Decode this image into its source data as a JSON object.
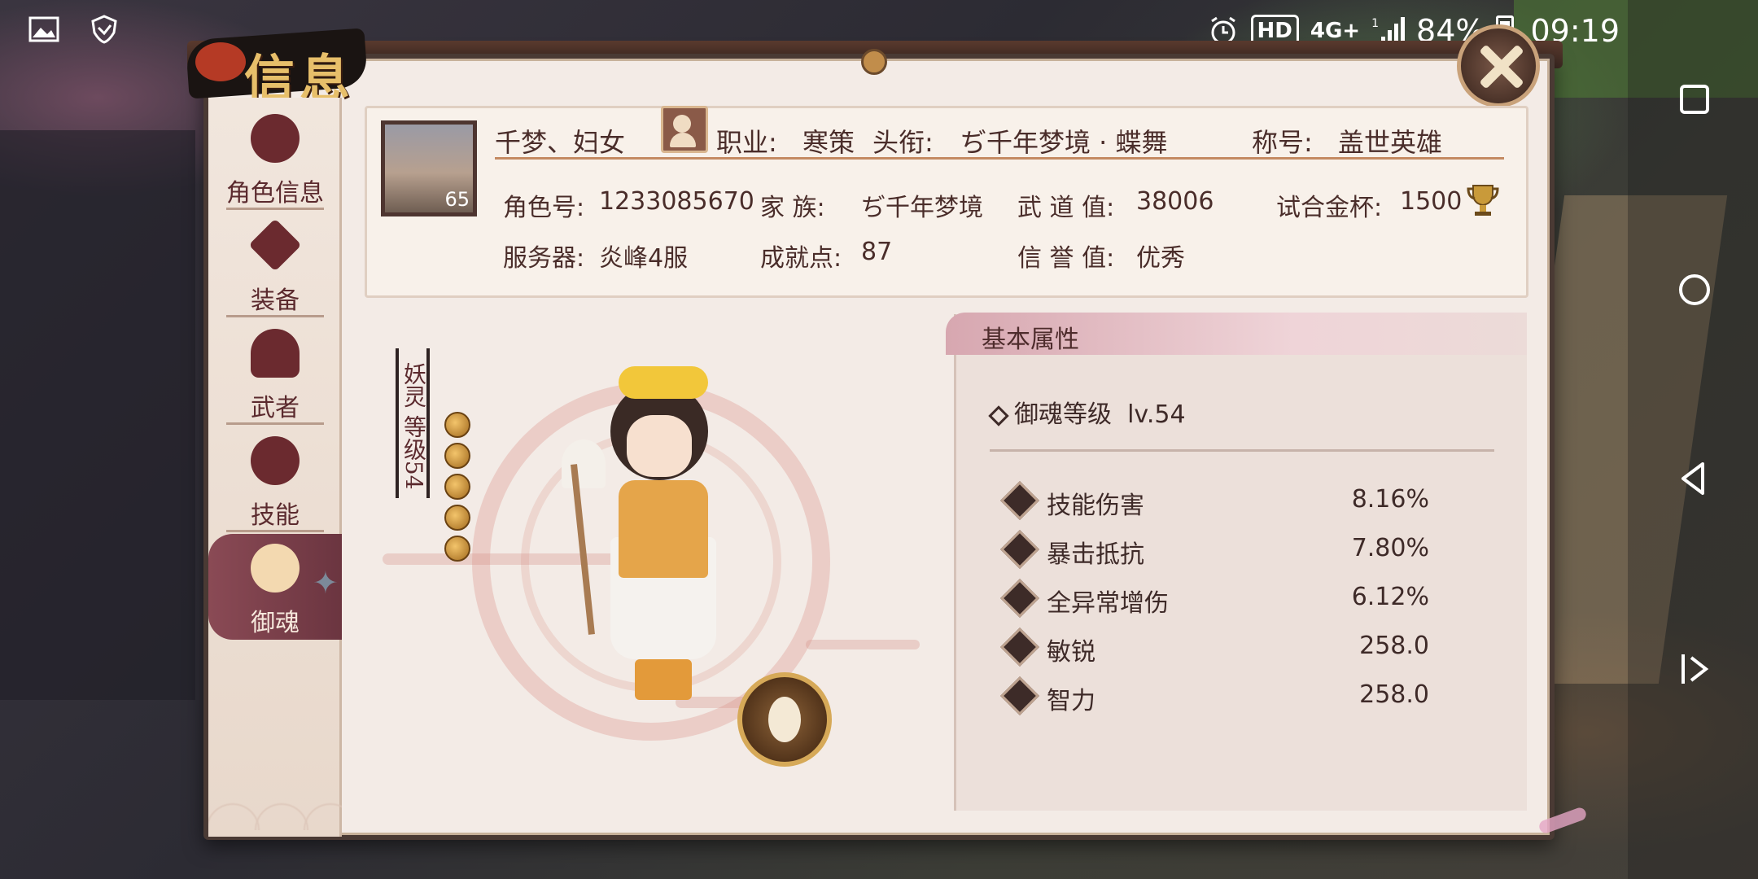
{
  "status_bar": {
    "network": "4G+",
    "signal_bars": "1",
    "battery": "84%",
    "time": "09:19",
    "hd_label": "HD"
  },
  "window": {
    "title": "信息"
  },
  "sidebar": {
    "items": [
      {
        "label": "角色信息",
        "icon": "character-info-icon"
      },
      {
        "label": "装备",
        "icon": "equipment-swords-icon"
      },
      {
        "label": "武者",
        "icon": "warrior-helmet-icon"
      },
      {
        "label": "技能",
        "icon": "skill-swirl-icon"
      },
      {
        "label": "御魂",
        "icon": "soul-fox-icon",
        "active": true
      }
    ]
  },
  "profile": {
    "avatar_level": "65",
    "name": "千梦、妇女",
    "class_label": "职业:",
    "class_value": "寒策",
    "rank_label": "头衔:",
    "rank_value": "ぢ千年梦境 · 蝶舞",
    "title_label": "称号:",
    "title_value": "盖世英雄",
    "role_id_label": "角色号:",
    "role_id": "1233085670",
    "clan_label": "家  族:",
    "clan_value": "ぢ千年梦境",
    "martial_label": "武 道 值:",
    "martial_value": "38006",
    "cup_label": "试合金杯:",
    "cup_value": "1500",
    "server_label": "服务器:",
    "server_value": "炎峰4服",
    "achievement_label": "成就点:",
    "achievement_value": "87",
    "credit_label": "信 誉 值:",
    "credit_value": "优秀"
  },
  "soul": {
    "vertical_label": "妖灵 等级54",
    "orb_count": 5
  },
  "attributes": {
    "header": "基本属性",
    "level_label": "御魂等级",
    "level_value": "lv.54",
    "stats": [
      {
        "name": "技能伤害",
        "value": "8.16%",
        "icon": "skill-damage-icon"
      },
      {
        "name": "暴击抵抗",
        "value": "7.80%",
        "icon": "crit-resist-icon"
      },
      {
        "name": "全异常增伤",
        "value": "6.12%",
        "icon": "debuff-damage-icon"
      },
      {
        "name": "敏锐",
        "value": "258.0",
        "icon": "agility-icon"
      },
      {
        "name": "智力",
        "value": "258.0",
        "icon": "intelligence-icon"
      }
    ]
  }
}
